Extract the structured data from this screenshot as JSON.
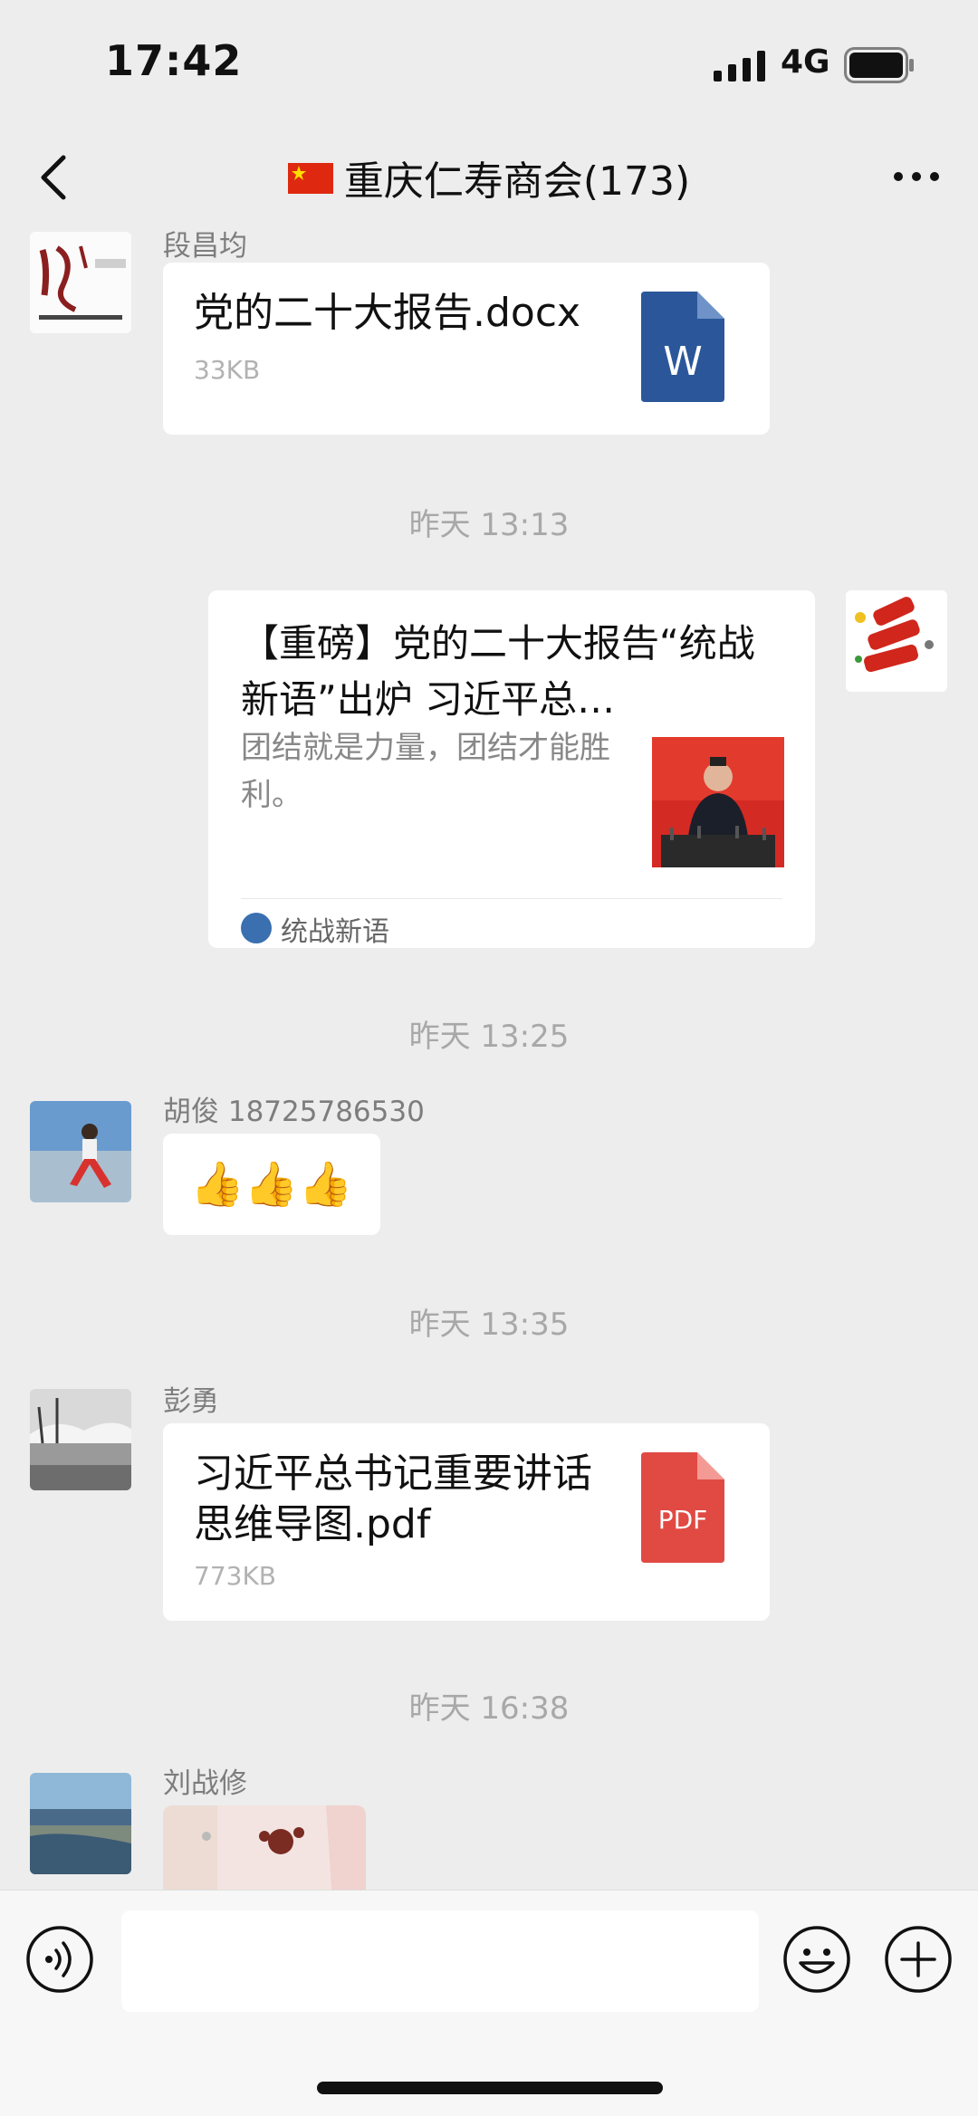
{
  "status_bar": {
    "time": "17:42",
    "network": "4G",
    "icons": [
      "signal-icon",
      "battery-icon"
    ]
  },
  "nav": {
    "flag": "🇨🇳",
    "title": "重庆仁寿商会(173)",
    "icons": [
      "back-icon",
      "more-icon"
    ]
  },
  "messages": [
    {
      "sender": "段昌均",
      "type": "file",
      "file_name": "党的二十大报告.docx",
      "file_size": "33KB",
      "file_icon_label": "W",
      "file_icon_color": "#2b579a"
    },
    {
      "timestamp": "昨天 13:13"
    },
    {
      "type": "article",
      "outgoing": true,
      "title": "【重磅】党的二十大报告“统战新语”出炉 习近平总…",
      "description": "团结就是力量，团结才能胜利。",
      "source": "统战新语"
    },
    {
      "timestamp": "昨天 13:25"
    },
    {
      "sender": "胡俊 18725786530",
      "type": "emoji",
      "content": "👍👍👍"
    },
    {
      "timestamp": "昨天 13:35"
    },
    {
      "sender": "彭勇",
      "type": "file",
      "file_name": "习近平总书记重要讲话思维导图.pdf",
      "file_size": "773KB",
      "file_icon_label": "PDF",
      "file_icon_color": "#e04a43"
    },
    {
      "timestamp": "昨天 16:38"
    },
    {
      "sender": "刘战修",
      "type": "image"
    }
  ],
  "input_bar": {
    "message_value": "",
    "icons": [
      "voice-icon",
      "emoji-icon",
      "plus-icon"
    ]
  },
  "colors": {
    "background": "#ededed",
    "bubble": "#ffffff",
    "timestamp": "#a8a8a8",
    "word_blue": "#2b579a",
    "pdf_red": "#e04a43"
  }
}
